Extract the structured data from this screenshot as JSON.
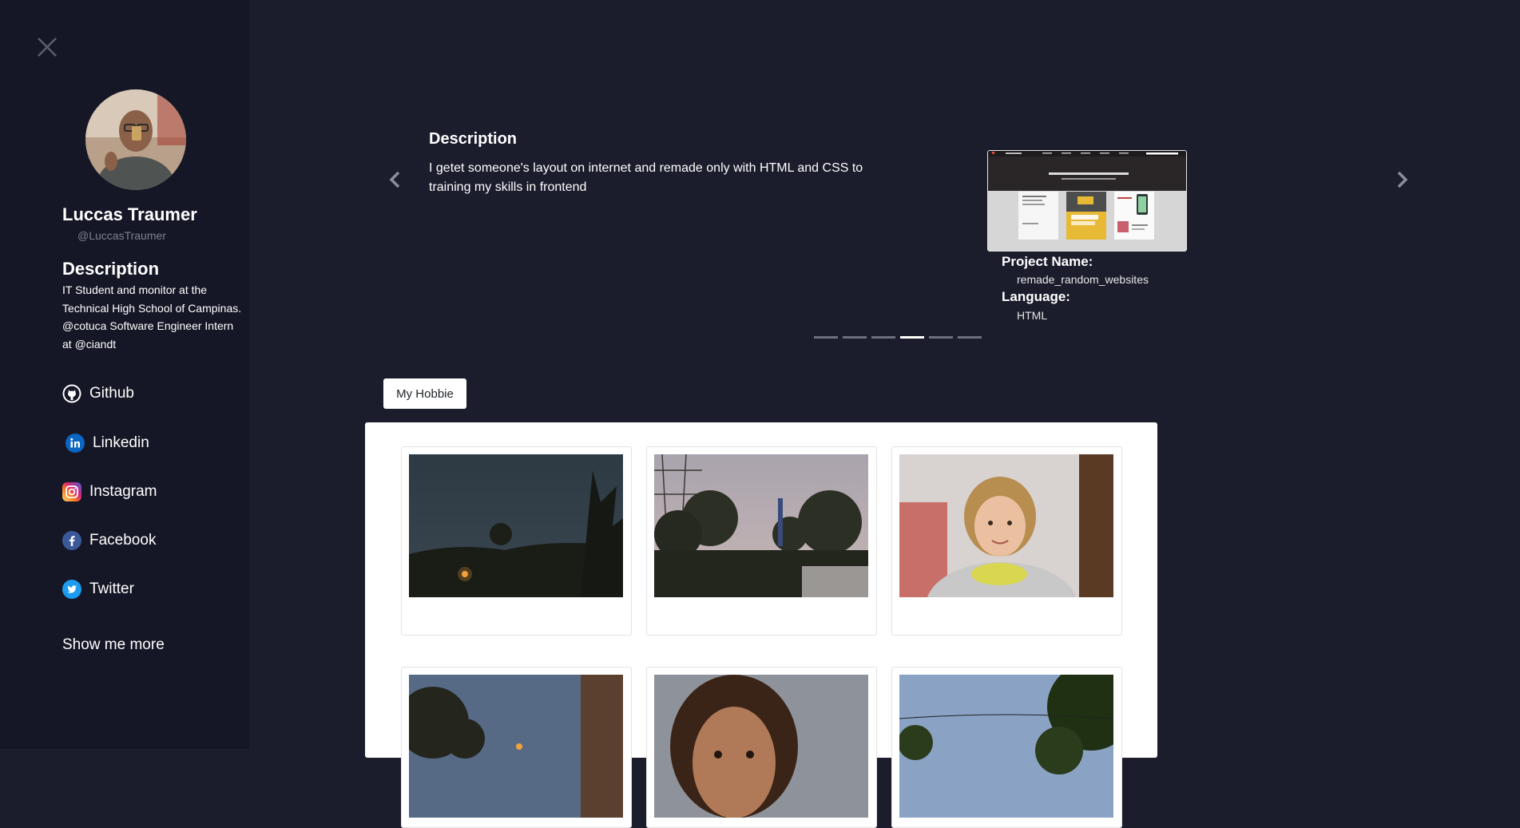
{
  "sidebar": {
    "close_icon": "close-icon",
    "profile": {
      "name": "Luccas Traumer",
      "handle": "@LuccasTraumer"
    },
    "description": {
      "title": "Description",
      "lines": [
        "IT Student and monitor at the",
        "Technical High School of Campinas.",
        "@cotuca Software Engineer Intern",
        "at @ciandt"
      ]
    },
    "links": [
      {
        "label": "Github",
        "icon": "github-icon"
      },
      {
        "label": "Linkedin",
        "icon": "linkedin-icon"
      },
      {
        "label": "Instagram",
        "icon": "instagram-icon"
      },
      {
        "label": "Facebook",
        "icon": "facebook-icon"
      },
      {
        "label": "Twitter",
        "icon": "twitter-icon"
      }
    ],
    "show_more": "Show me more"
  },
  "carousel": {
    "slide": {
      "title": "Description",
      "description": "I getet someone's layout on internet and remade only with HTML and CSS to training my skills in frontend",
      "project_name_label": "Project Name:",
      "project_name": "remade_random_websites",
      "language_label": "Language:",
      "language": "HTML"
    },
    "indicator_count": 6,
    "active_indicator": 4
  },
  "hobbie": {
    "button_label": "My Hobbie"
  },
  "colors": {
    "background": "#1b1c2c",
    "sidebar": "#161726",
    "accent_linkedin": "#0a66c2",
    "accent_twitter": "#1d9bf0",
    "accent_facebook": "#3b5998"
  }
}
